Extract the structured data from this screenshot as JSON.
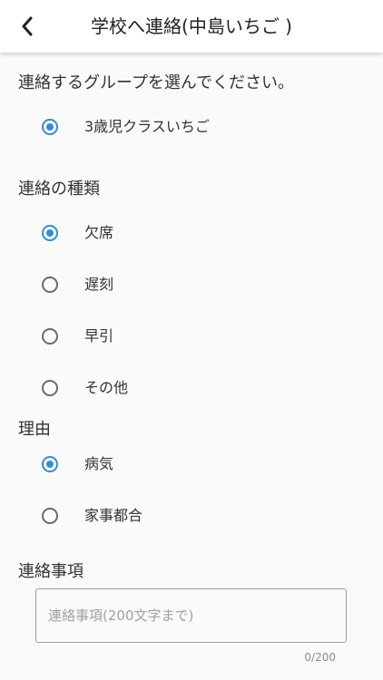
{
  "header": {
    "title": "学校へ連絡(中島いちご )"
  },
  "group_section": {
    "title": "連絡するグループを選んでください。",
    "options": [
      {
        "label": "3歳児クラスいちご",
        "checked": true
      }
    ]
  },
  "type_section": {
    "title": "連絡の種類",
    "options": [
      {
        "label": "欠席",
        "checked": true
      },
      {
        "label": "遅刻",
        "checked": false
      },
      {
        "label": "早引",
        "checked": false
      },
      {
        "label": "その他",
        "checked": false
      }
    ]
  },
  "reason_section": {
    "title": "理由",
    "options": [
      {
        "label": "病気",
        "checked": true
      },
      {
        "label": "家事都合",
        "checked": false
      }
    ]
  },
  "message_section": {
    "title": "連絡事項",
    "placeholder": "連絡事項(200文字まで)",
    "counter": "0/200"
  },
  "colors": {
    "accent": "#2f8fd8",
    "background": "#fafafa"
  }
}
